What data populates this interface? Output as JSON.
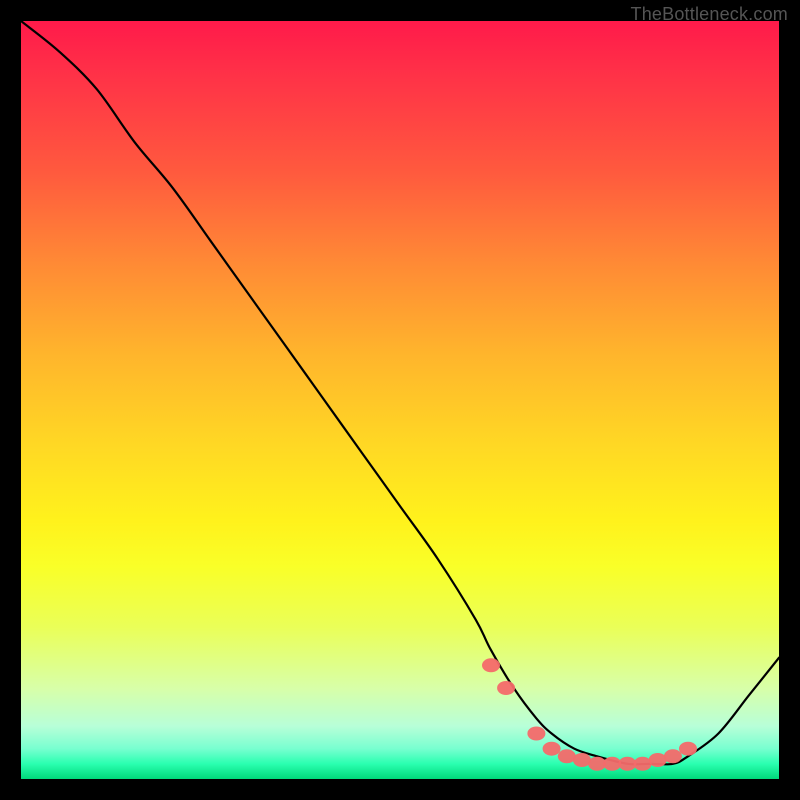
{
  "watermark": "TheBottleneck.com",
  "chart_data": {
    "type": "line",
    "title": "",
    "xlabel": "",
    "ylabel": "",
    "xlim": [
      0,
      100
    ],
    "ylim": [
      0,
      100
    ],
    "series": [
      {
        "name": "bottleneck-curve",
        "x": [
          0,
          5,
          10,
          15,
          20,
          25,
          30,
          35,
          40,
          45,
          50,
          55,
          60,
          62,
          65,
          68,
          70,
          73,
          76,
          80,
          83,
          86,
          88,
          92,
          96,
          100
        ],
        "values": [
          100,
          96,
          91,
          84,
          78,
          71,
          64,
          57,
          50,
          43,
          36,
          29,
          21,
          17,
          12,
          8,
          6,
          4,
          3,
          2,
          2,
          2,
          3,
          6,
          11,
          16
        ]
      }
    ],
    "markers": {
      "name": "highlight-dots",
      "x": [
        62,
        64,
        68,
        70,
        72,
        74,
        76,
        78,
        80,
        82,
        84,
        86,
        88
      ],
      "values": [
        15,
        12,
        6,
        4,
        3,
        2.5,
        2,
        2,
        2,
        2,
        2.5,
        3,
        4
      ],
      "color": "#f46a6a"
    },
    "gradient_stops": [
      {
        "pos": 0,
        "color": "#ff1a4a"
      },
      {
        "pos": 20,
        "color": "#ff5a3e"
      },
      {
        "pos": 44,
        "color": "#ffb52c"
      },
      {
        "pos": 66,
        "color": "#fff21c"
      },
      {
        "pos": 88,
        "color": "#d8ffa8"
      },
      {
        "pos": 100,
        "color": "#00d97a"
      }
    ]
  }
}
